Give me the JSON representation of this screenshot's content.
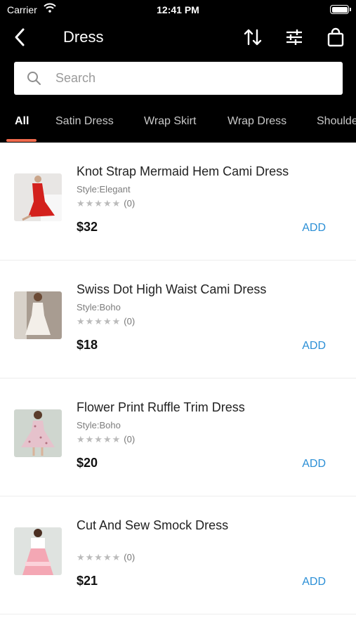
{
  "status_bar": {
    "carrier": "Carrier",
    "time": "12:41 PM"
  },
  "nav": {
    "title": "Dress"
  },
  "search": {
    "placeholder": "Search"
  },
  "tabs": [
    {
      "label": "All",
      "active": true
    },
    {
      "label": "Satin Dress"
    },
    {
      "label": "Wrap Skirt"
    },
    {
      "label": "Wrap Dress"
    },
    {
      "label": "Shoulde"
    }
  ],
  "products": [
    {
      "name": "Knot Strap Mermaid Hem Cami Dress",
      "style": "Style:Elegant",
      "rating": "★★★★★",
      "reviews": "(0)",
      "price": "$32",
      "add_label": "ADD",
      "thumb_color": "#d3211d"
    },
    {
      "name": "Swiss Dot High Waist Cami Dress",
      "style": "Style:Boho",
      "rating": "★★★★★",
      "reviews": "(0)",
      "price": "$18",
      "add_label": "ADD",
      "thumb_color": "#f3efe9"
    },
    {
      "name": "Flower Print Ruffle Trim Dress",
      "style": "Style:Boho",
      "rating": "★★★★★",
      "reviews": "(0)",
      "price": "$20",
      "add_label": "ADD",
      "thumb_color": "#e6c2cc"
    },
    {
      "name": "Cut And Sew Smock Dress",
      "style": "",
      "rating": "★★★★★",
      "reviews": "(0)",
      "price": "$21",
      "add_label": "ADD",
      "thumb_color": "#f4a7b4"
    }
  ],
  "colors": {
    "header_bg": "#000000",
    "tab_indicator": "#f06a4d",
    "add_link": "#2b8fd6"
  },
  "icons": [
    "wifi-icon",
    "battery-icon",
    "back-arrow-icon",
    "sort-icon",
    "filter-icon",
    "shopping-bag-icon",
    "search-icon"
  ]
}
